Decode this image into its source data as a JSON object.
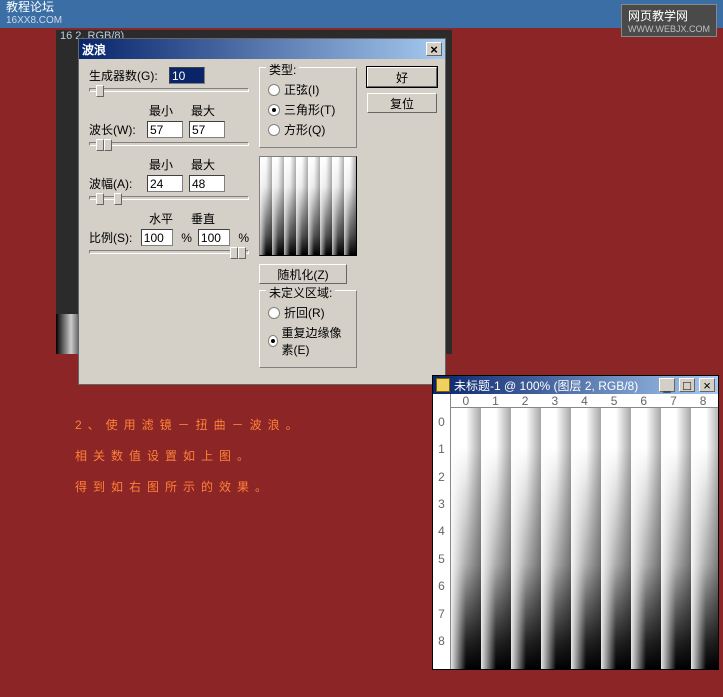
{
  "topbar": {
    "title": "教程论坛",
    "sub": "16XX8.COM"
  },
  "logo": {
    "text": "网页教学网",
    "url": "WWW.WEBJX.COM"
  },
  "bg_hint": "16 2, RGB/8)",
  "outer_hint": "－|□| ×|",
  "dialog": {
    "title": "波浪",
    "generators_label": "生成器数(G):",
    "generators_value": "10",
    "min_label": "最小",
    "max_label": "最大",
    "wavelength_label": "波长(W):",
    "wavelength_min": "57",
    "wavelength_max": "57",
    "amplitude_label": "波幅(A):",
    "amplitude_min": "24",
    "amplitude_max": "48",
    "horiz_label": "水平",
    "vert_label": "垂直",
    "scale_label": "比例(S):",
    "scale_h": "100",
    "scale_v": "100",
    "pct": "%",
    "type_label": "类型:",
    "type_options": [
      "正弦(I)",
      "三角形(T)",
      "方形(Q)"
    ],
    "type_selected": 1,
    "randomize": "随机化(Z)",
    "undefined_label": "未定义区域:",
    "undefined_options": [
      "折回(R)",
      "重复边缘像素(E)"
    ],
    "undefined_selected": 1,
    "ok": "好",
    "cancel": "复位"
  },
  "ps": {
    "title": "未标题-1 @ 100% (图层 2, RGB/8)",
    "ruler_h": [
      "0",
      "1",
      "2",
      "3",
      "4",
      "5",
      "6",
      "7",
      "8"
    ],
    "ruler_v": [
      "0",
      "1",
      "2",
      "3",
      "4",
      "5",
      "6",
      "7",
      "8"
    ]
  },
  "instruct": {
    "l1": "2、使用滤镜－扭曲－波浪。",
    "l2": "相关数值设置如上图。",
    "l3": "得到如右图所示的效果。"
  }
}
